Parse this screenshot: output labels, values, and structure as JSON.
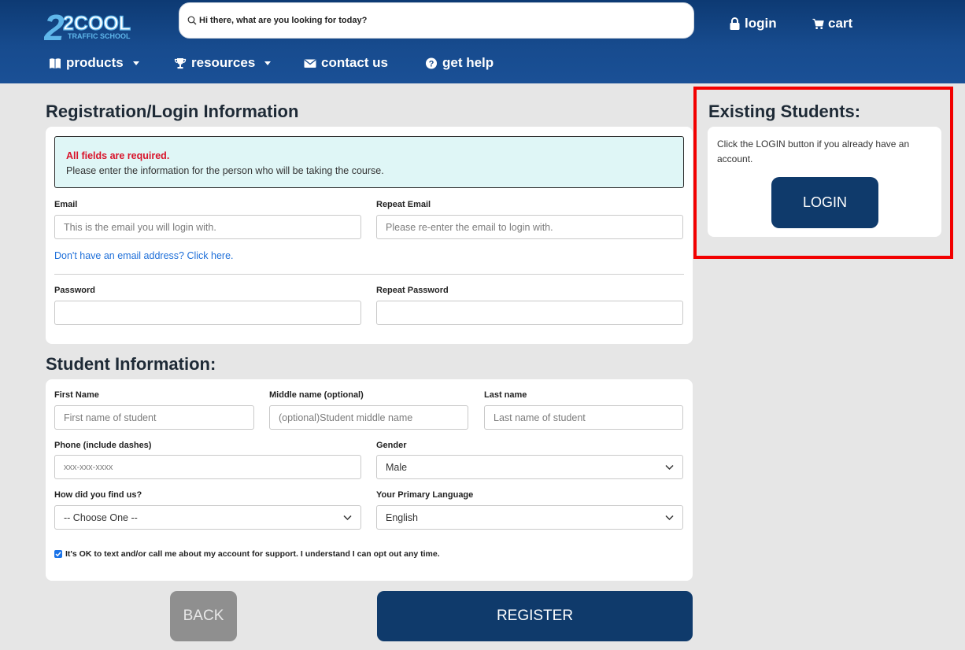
{
  "header": {
    "logo_text": "2COOL",
    "logo_sub": "TRAFFIC SCHOOL",
    "search_placeholder": "Hi there, what are you looking for today?",
    "login_label": "login",
    "cart_label": "cart",
    "nav": [
      {
        "label": "products",
        "icon": "book-icon",
        "dropdown": true
      },
      {
        "label": "resources",
        "icon": "trophy-icon",
        "dropdown": true
      },
      {
        "label": "contact us",
        "icon": "envelope-icon",
        "dropdown": false
      },
      {
        "label": "get help",
        "icon": "help-icon",
        "dropdown": false
      }
    ]
  },
  "registration": {
    "title": "Registration/Login Information",
    "notice_required": "All fields are required.",
    "notice_message": "Please enter the information for the person who will be taking the course.",
    "email_label": "Email",
    "email_placeholder": "This is the email you will login with.",
    "repeat_email_label": "Repeat Email",
    "repeat_email_placeholder": "Please re-enter the email to login with.",
    "no_email_link": "Don't have an email address? Click here.",
    "password_label": "Password",
    "repeat_password_label": "Repeat Password"
  },
  "student": {
    "title": "Student Information:",
    "first_name_label": "First Name",
    "first_name_placeholder": "First name of student",
    "middle_name_label": "Middle name (optional)",
    "middle_name_placeholder": "(optional)Student middle name",
    "last_name_label": "Last name",
    "last_name_placeholder": "Last name of student",
    "phone_label": "Phone (include dashes)",
    "phone_placeholder": "xxx-xxx-xxxx",
    "gender_label": "Gender",
    "gender_value": "Male",
    "find_us_label": "How did you find us?",
    "find_us_value": "-- Choose One --",
    "language_label": "Your Primary Language",
    "language_value": "English",
    "consent_text": "It's OK to text and/or call me about my account for support. I understand I can opt out any time.",
    "consent_checked": true
  },
  "buttons": {
    "back_label": "BACK",
    "register_label": "REGISTER"
  },
  "existing": {
    "title": "Existing Students:",
    "text": "Click the LOGIN button if you already have an account.",
    "login_button": "LOGIN"
  },
  "colors": {
    "header_blue": "#174b8e",
    "button_navy": "#0f3a6b",
    "highlight_red": "#f20000",
    "required_red": "#d9142b",
    "link_blue": "#1e6fd9"
  }
}
